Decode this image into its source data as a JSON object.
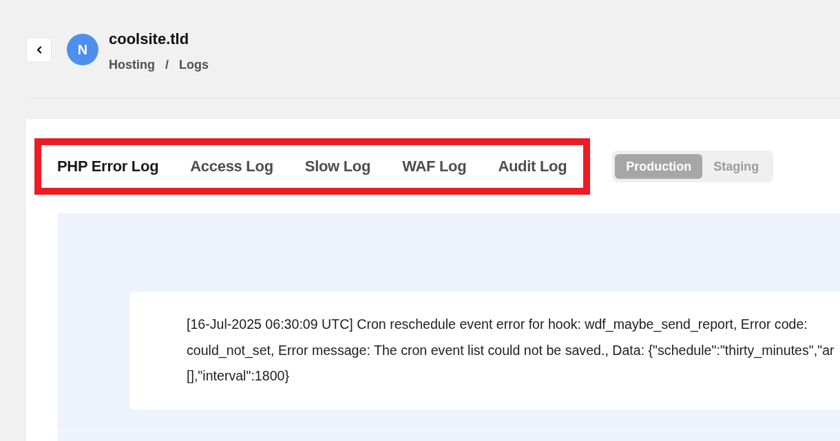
{
  "site": {
    "avatar_initial": "N",
    "title": "coolsite.tld",
    "breadcrumb": [
      {
        "label": "Hosting"
      },
      {
        "label": "Logs"
      }
    ],
    "breadcrumb_separator": "/"
  },
  "log_tabs": {
    "highlighted": true,
    "tabs": [
      {
        "label": "PHP Error Log",
        "selected": true
      },
      {
        "label": "Access Log",
        "selected": false
      },
      {
        "label": "Slow Log",
        "selected": false
      },
      {
        "label": "WAF Log",
        "selected": false
      },
      {
        "label": "Audit Log",
        "selected": false
      }
    ]
  },
  "environment": [
    {
      "label": "Production",
      "selected": true
    },
    {
      "label": "Staging",
      "selected": false
    }
  ],
  "log_entries": [
    {
      "lines": [
        "[16-Jul-2025 06:30:09 UTC] Cron reschedule event error for hook: wdf_maybe_send_report, Error code:",
        "could_not_set, Error message: The cron event list could not be saved., Data: {\"schedule\":\"thirty_minutes\",\"ar",
        "[],\"interval\":1800}"
      ]
    }
  ]
}
